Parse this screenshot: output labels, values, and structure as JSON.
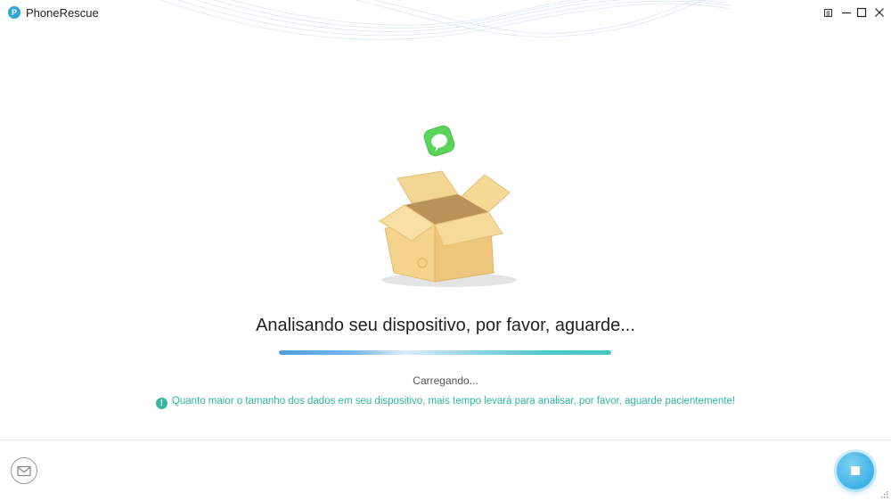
{
  "window": {
    "title": "PhoneRescue",
    "logo_letter": "P",
    "controls": [
      "pin-icon",
      "minimize-icon",
      "maximize-icon",
      "close-icon"
    ]
  },
  "main": {
    "status_title": "Analisando seu dispositivo, por favor, aguarde...",
    "progress_percent": 100,
    "loading_text": "Carregando...",
    "hint_icon": "!",
    "hint_text": "Quanto maior o tamanho dos dados em seu dispositivo, mais tempo levará para analisar, por favor, aguarde pacientemente!"
  },
  "footer": {
    "mail_icon": "mail-icon",
    "stop_icon": "stop-icon"
  },
  "colors": {
    "accent": "#2fa7d6",
    "hint": "#2fb5a0",
    "progress_start": "#4e9ee4",
    "progress_end": "#44c6bd"
  }
}
